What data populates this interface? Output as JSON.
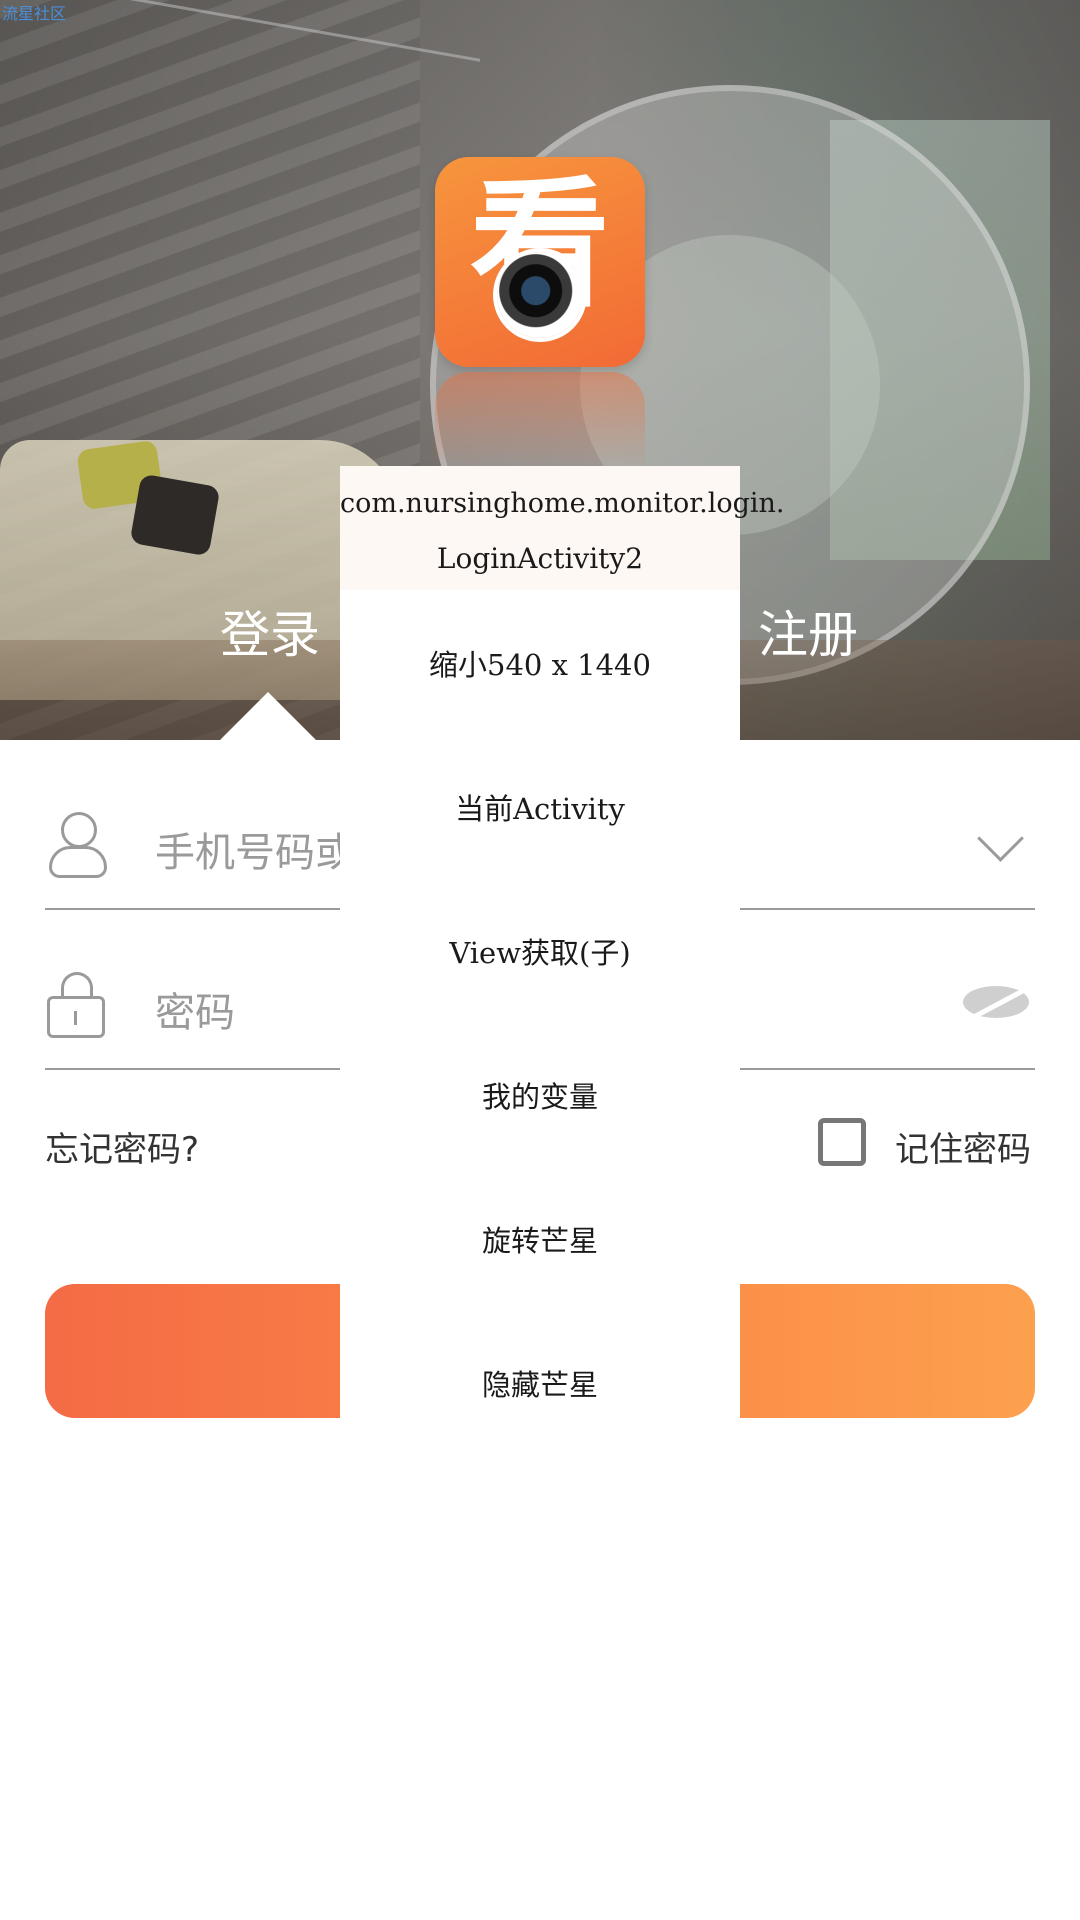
{
  "watermark": "流星社区",
  "header": {
    "tabs": [
      {
        "label": "登录"
      },
      {
        "label": "注册"
      }
    ]
  },
  "login_form": {
    "phone_placeholder": "手机号码或",
    "password_placeholder": "密码",
    "forgot_password": "忘记密码?",
    "remember_password": "记住密码",
    "remember_checked": false
  },
  "overlay": {
    "activity_line1": "com.nursinghome.monitor.login.",
    "activity_line2": "LoginActivity2",
    "items": [
      {
        "label": "缩小540 x 1440"
      },
      {
        "label": "当前Activity"
      },
      {
        "label": "View获取(子)"
      },
      {
        "label": "我的变量"
      },
      {
        "label": "旋转芒星"
      },
      {
        "label": "隐藏芒星"
      }
    ]
  },
  "colors": {
    "accent_start": "#f46b45",
    "accent_end": "#fca04e",
    "watermark": "#4a8fdc"
  },
  "icons": [
    "app-logo-icon",
    "user-icon",
    "lock-icon",
    "chevron-down-icon",
    "eye-hidden-icon",
    "checkbox-icon"
  ]
}
